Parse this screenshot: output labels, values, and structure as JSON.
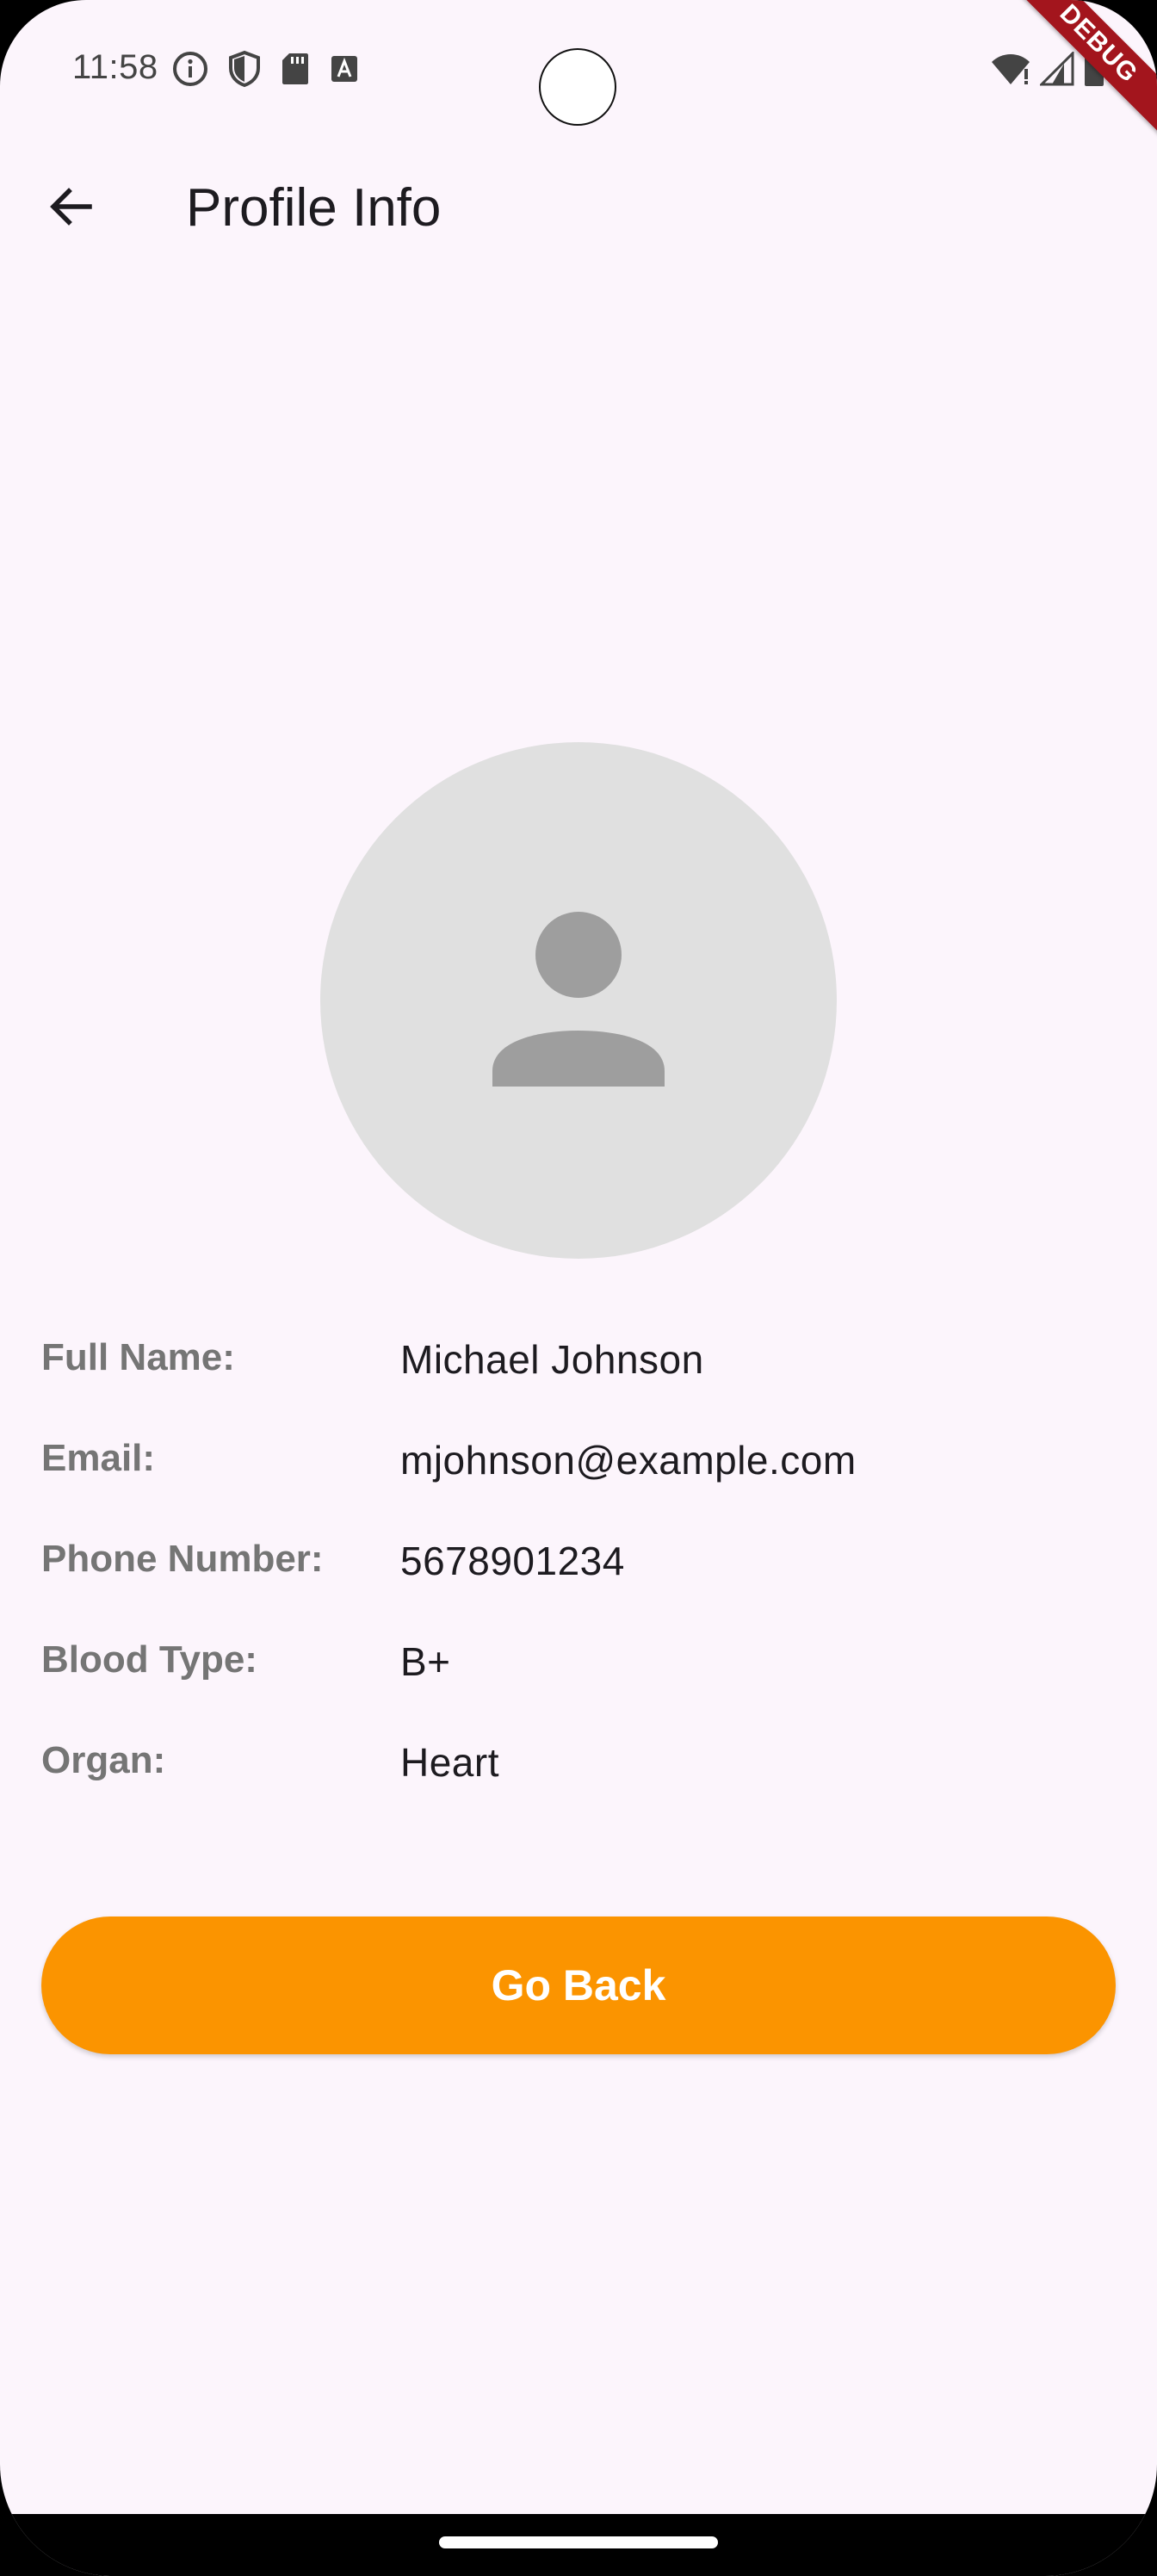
{
  "status_bar": {
    "time": "11:58",
    "left_icons": [
      "info-circle-icon",
      "shield-icon",
      "sd-card-icon",
      "a-box-icon"
    ],
    "right_icons": [
      "wifi-icon",
      "signal-icon",
      "battery-icon"
    ]
  },
  "debug_banner": "DEBUG",
  "app_bar": {
    "back_icon": "arrow-back-icon",
    "title": "Profile Info"
  },
  "avatar": {
    "icon": "person-icon",
    "background_color": "#E0E0E0",
    "icon_color": "#9E9E9E"
  },
  "profile": [
    {
      "label": "Full Name:",
      "value": "Michael Johnson"
    },
    {
      "label": "Email:",
      "value": "mjohnson@example.com"
    },
    {
      "label": "Phone Number:",
      "value": "5678901234"
    },
    {
      "label": "Blood Type:",
      "value": "B+"
    },
    {
      "label": "Organ:",
      "value": "Heart"
    }
  ],
  "button": {
    "label": "Go Back",
    "color": "#FB9400"
  },
  "colors": {
    "background": "#FCF5FC",
    "label_text": "#757575",
    "value_text": "#1D1B20",
    "debug_banner": "#A3151D"
  }
}
